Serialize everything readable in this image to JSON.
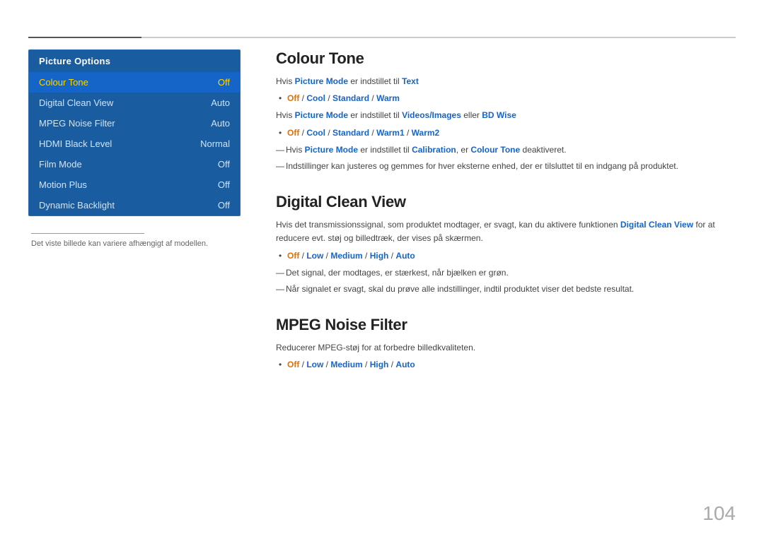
{
  "topbar": {},
  "left_panel": {
    "title": "Picture Options",
    "items": [
      {
        "label": "Colour Tone",
        "value": "Off",
        "active": true
      },
      {
        "label": "Digital Clean View",
        "value": "Auto",
        "active": false
      },
      {
        "label": "MPEG Noise Filter",
        "value": "Auto",
        "active": false
      },
      {
        "label": "HDMI Black Level",
        "value": "Normal",
        "active": false
      },
      {
        "label": "Film Mode",
        "value": "Off",
        "active": false
      },
      {
        "label": "Motion Plus",
        "value": "Off",
        "active": false
      },
      {
        "label": "Dynamic Backlight",
        "value": "Off",
        "active": false
      }
    ],
    "note": "Det viste billede kan variere afhængigt af modellen."
  },
  "sections": [
    {
      "id": "colour-tone",
      "title": "Colour Tone",
      "paragraphs": [
        {
          "type": "text",
          "text": "Hvis Picture Mode er indstillet til Text"
        },
        {
          "type": "bullet",
          "items": [
            "Off / Cool / Standard / Warm"
          ]
        },
        {
          "type": "text",
          "text": "Hvis Picture Mode er indstillet til Videos/Images eller BD Wise"
        },
        {
          "type": "bullet",
          "items": [
            "Off / Cool / Standard / Warm1 / Warm2"
          ]
        },
        {
          "type": "note",
          "text": "Hvis Picture Mode er indstillet til Calibration, er Colour Tone deaktiveret."
        },
        {
          "type": "note",
          "text": "Indstillinger kan justeres og gemmes for hver eksterne enhed, der er tilsluttet til en indgang på produktet."
        }
      ]
    },
    {
      "id": "digital-clean-view",
      "title": "Digital Clean View",
      "paragraphs": [
        {
          "type": "text",
          "text": "Hvis det transmissionssignal, som produktet modtager, er svagt, kan du aktivere funktionen Digital Clean View for at reducere evt. støj og billedtræk, der vises på skærmen."
        },
        {
          "type": "bullet",
          "items": [
            "Off / Low / Medium / High / Auto"
          ]
        },
        {
          "type": "note",
          "text": "Det signal, der modtages, er stærkest, når bjælken er grøn."
        },
        {
          "type": "note",
          "text": "Når signalet er svagt, skal du prøve alle indstillinger, indtil produktet viser det bedste resultat."
        }
      ]
    },
    {
      "id": "mpeg-noise-filter",
      "title": "MPEG Noise Filter",
      "paragraphs": [
        {
          "type": "text",
          "text": "Reducerer MPEG-støj for at forbedre billedkvaliteten."
        },
        {
          "type": "bullet",
          "items": [
            "Off / Low / Medium / High / Auto"
          ]
        }
      ]
    }
  ],
  "page_number": "104"
}
